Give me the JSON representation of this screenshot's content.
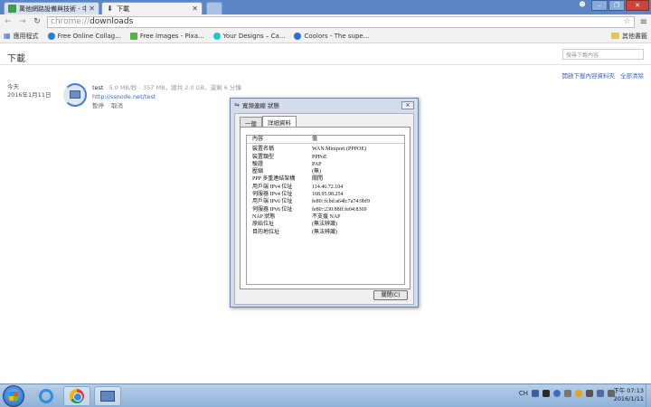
{
  "tabs": [
    {
      "title": "萬他網路設備與技術 - 中3",
      "active": false
    },
    {
      "title": "下載",
      "active": true
    }
  ],
  "omnibox": {
    "scheme": "chrome://",
    "path": "downloads"
  },
  "bookmarks": {
    "apps_label": "應用程式",
    "items": [
      "Free Online Collag...",
      "Free Images - Pixa...",
      "Your Designs – Ca...",
      "Coolors - The supe..."
    ],
    "other_label": "其他書籤"
  },
  "downloads": {
    "title": "下載",
    "search_placeholder": "搜尋下載內容",
    "actions": [
      "開啟下載內容資料夾",
      "全部清除"
    ],
    "item": {
      "date_line1": "今天",
      "date_line2": "2016年1月11日",
      "name": "test",
      "progress": "5.0 MB/秒 - 357 MB，總共 2.0 GB，還剩 6 分鐘",
      "url": "http://ssnode.net/test",
      "pause": "暫停",
      "cancel": "取消"
    }
  },
  "dialog": {
    "title": "寬頻連線 狀態",
    "tabs": [
      "一般",
      "詳細資料"
    ],
    "header": {
      "key": "內容",
      "value": "值"
    },
    "rows": [
      {
        "k": "裝置名稱",
        "v": "WAN Miniport (PPPOE)"
      },
      {
        "k": "裝置類型",
        "v": "PPPoE"
      },
      {
        "k": "驗證",
        "v": "PAP"
      },
      {
        "k": "壓縮",
        "v": "(無)"
      },
      {
        "k": "PPP 多重連結架構",
        "v": "關閉"
      },
      {
        "k": "用戶端 IPv4 位址",
        "v": "114.46.72.104"
      },
      {
        "k": "伺服器 IPv4 位址",
        "v": "168.95.98.254"
      },
      {
        "k": "用戶端 IPv6 位址",
        "v": "fe80::fcbd:a64b:7a74:9bf9"
      },
      {
        "k": "伺服器 IPv6 位址",
        "v": "fe80::230:88ff:fe04:8369"
      },
      {
        "k": "NAP 狀態",
        "v": "不支援 NAP"
      },
      {
        "k": "原始位址",
        "v": "(無法辨識)"
      },
      {
        "k": "目的地位址",
        "v": "(無法辨識)"
      }
    ],
    "close_button": "關閉(C)"
  },
  "taskbar": {
    "tray_lang": "CH",
    "time": "下午 07:13",
    "date": "2016/1/11"
  },
  "colors": {
    "tabstrip": "#5a86c7",
    "link": "#3b66c4",
    "taskbar": "#9dbbe0"
  }
}
